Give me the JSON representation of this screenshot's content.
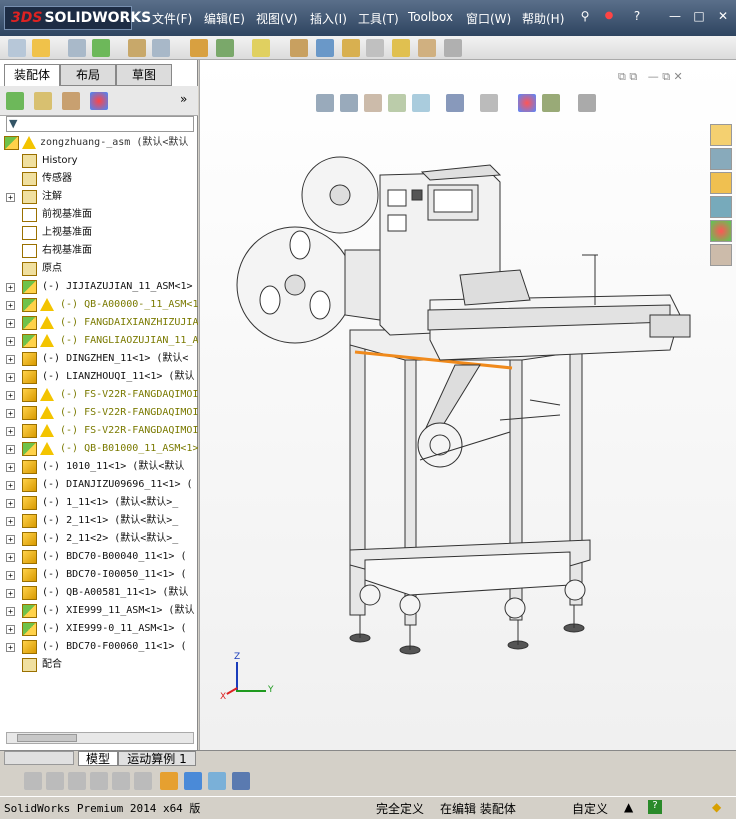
{
  "app": {
    "logo_brand": "3DS",
    "logo_text": "SOLIDWORKS"
  },
  "menu": [
    "文件(F)",
    "编辑(E)",
    "视图(V)",
    "插入(I)",
    "工具(T)",
    "Toolbox",
    "窗口(W)",
    "帮助(H)"
  ],
  "window_controls": {
    "help": "?",
    "minimize": "—",
    "restore": "□",
    "close": "✕"
  },
  "tabs": {
    "assembly": "装配体",
    "layout": "布局",
    "sketch": "草图"
  },
  "tree": {
    "root": "zongzhuang-_asm  (默认<默认",
    "items": [
      {
        "label": "History",
        "kind": "history"
      },
      {
        "label": "传感器",
        "kind": "sensor"
      },
      {
        "label": "注解",
        "kind": "annot",
        "exp": true
      },
      {
        "label": "前视基准面",
        "kind": "plane"
      },
      {
        "label": "上视基准面",
        "kind": "plane"
      },
      {
        "label": "右视基准面",
        "kind": "plane"
      },
      {
        "label": "原点",
        "kind": "origin"
      },
      {
        "label": "(-) JIJIAZUJIAN_11_ASM<1>",
        "kind": "asm",
        "exp": true
      },
      {
        "label": "(-) QB-A00000-_11_ASM<1",
        "kind": "asm",
        "warn": true,
        "exp": true
      },
      {
        "label": "(-) FANGDAIXIANZHIZUJIA",
        "kind": "asm",
        "warn": true,
        "exp": true
      },
      {
        "label": "(-) FANGLIAOZUJIAN_11_A",
        "kind": "asm",
        "warn": true,
        "exp": true
      },
      {
        "label": "(-) DINGZHEN_11<1> (默认<",
        "kind": "part",
        "exp": true
      },
      {
        "label": "(-) LIANZHOUQI_11<1> (默认",
        "kind": "part",
        "exp": true
      },
      {
        "label": "(-) FS-V22R-FANGDAQIMOI",
        "kind": "part",
        "warn": true,
        "exp": true
      },
      {
        "label": "(-) FS-V22R-FANGDAQIMOI",
        "kind": "part",
        "warn": true,
        "exp": true
      },
      {
        "label": "(-) FS-V22R-FANGDAQIMOI",
        "kind": "part",
        "warn": true,
        "exp": true
      },
      {
        "label": "(-) QB-B01000_11_ASM<1>",
        "kind": "asm",
        "warn": true,
        "exp": true
      },
      {
        "label": "(-) 1010_11<1> (默认<默认",
        "kind": "part",
        "exp": true
      },
      {
        "label": "(-) DIANJIZU09696_11<1> (",
        "kind": "part",
        "exp": true
      },
      {
        "label": "(-) 1_11<1> (默认<默认>_",
        "kind": "part",
        "exp": true
      },
      {
        "label": "(-) 2_11<1> (默认<默认>_",
        "kind": "part",
        "exp": true
      },
      {
        "label": "(-) 2_11<2> (默认<默认>_",
        "kind": "part",
        "exp": true
      },
      {
        "label": "(-) BDC70-B00040_11<1> (",
        "kind": "part",
        "exp": true
      },
      {
        "label": "(-) BDC70-I00050_11<1> (",
        "kind": "part",
        "exp": true
      },
      {
        "label": "(-) QB-A00581_11<1> (默认",
        "kind": "part",
        "exp": true
      },
      {
        "label": "(-) XIE999_11_ASM<1> (默认",
        "kind": "asm",
        "exp": true
      },
      {
        "label": "(-) XIE999-0_11_ASM<1> (",
        "kind": "asm",
        "exp": true
      },
      {
        "label": "(-) BDC70-F00060_11<1> (",
        "kind": "part",
        "exp": true
      },
      {
        "label": "配合",
        "kind": "mate"
      }
    ]
  },
  "bottom_tabs": {
    "model": "模型",
    "motion": "运动算例 1"
  },
  "status": {
    "app": "SolidWorks Premium 2014 x64 版",
    "defined": "完全定义",
    "editing": "在编辑 装配体",
    "units": "自定义"
  },
  "triad": {
    "x": "X",
    "y": "Y",
    "z": "Z"
  },
  "colors": {
    "title_bg": "#2e4460",
    "accent_red": "#d22020",
    "warn_yellow": "#f3c400",
    "highlight_orange": "#f08a1c"
  }
}
